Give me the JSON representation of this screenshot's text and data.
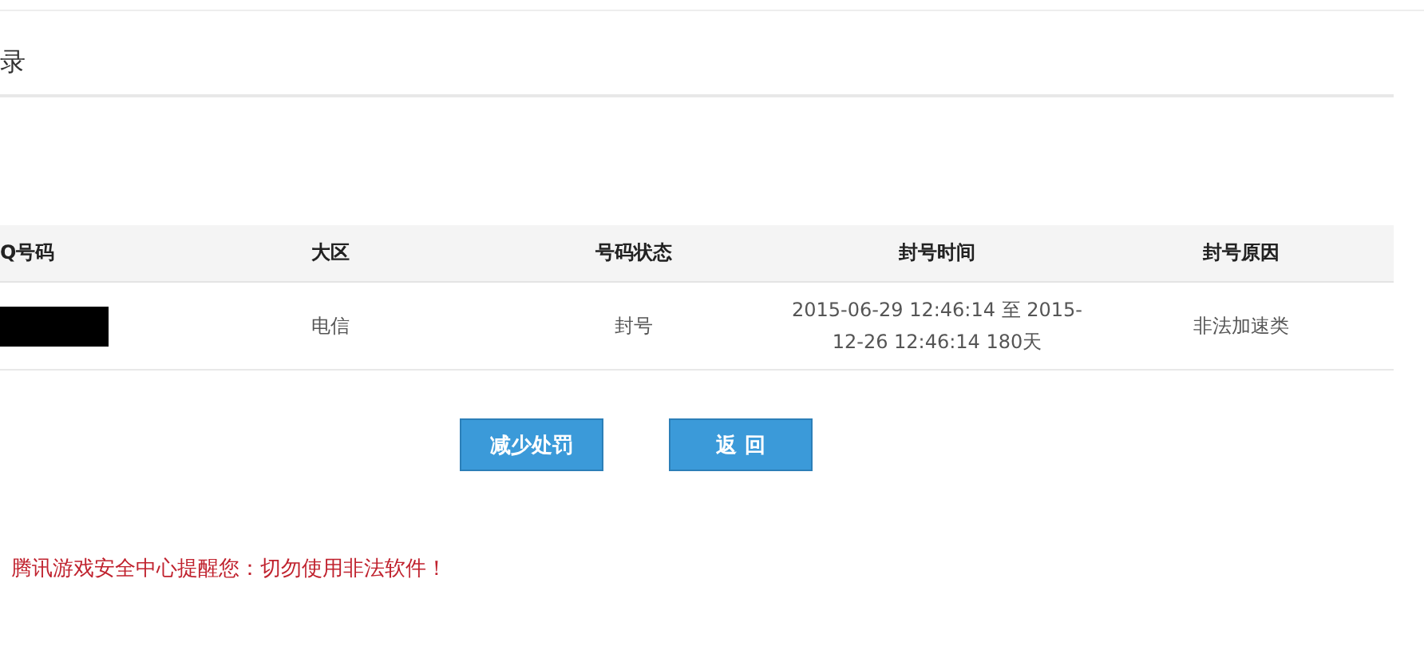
{
  "title": "录",
  "table": {
    "columns": [
      "Q号码",
      "大区",
      "号码状态",
      "封号时间",
      "封号原因"
    ],
    "rows": [
      {
        "qq_redacted": true,
        "cells": [
          "",
          "电信",
          "封号",
          "2015-06-29 12:46:14 至 2015-12-26 12:46:14 180天",
          "非法加速类"
        ]
      }
    ]
  },
  "buttons": [
    "减少处罚",
    "返 回"
  ],
  "notice": "腾讯游戏安全中心提醒您：切勿使用非法软件！"
}
